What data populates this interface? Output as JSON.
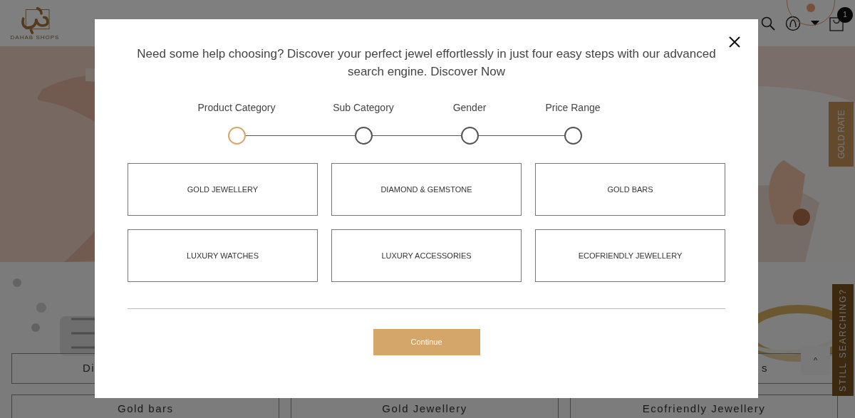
{
  "header": {
    "logo_text": "DAHAB SHOPS",
    "cart_count": "1"
  },
  "gold_rate_tab": "GOLD RATE",
  "still_searching_tab": "STILL SEARCHING?",
  "background_tiles": {
    "row_1": [
      "Di",
      "s"
    ],
    "row_2": [
      "Gold bars",
      "Gold Jewellery",
      "Ecofriendly Jewellery"
    ]
  },
  "scroll_top": "^",
  "modal": {
    "intro": "Need some help choosing? Discover your perfect jewel effortlessly in just four easy steps with our advanced search engine. Discover Now",
    "steps": [
      {
        "label": "Product Category",
        "selected": true
      },
      {
        "label": "Sub Category",
        "selected": false
      },
      {
        "label": "Gender",
        "selected": false
      },
      {
        "label": "Price Range",
        "selected": false
      }
    ],
    "options": [
      "GOLD JEWELLERY",
      "DIAMOND & GEMSTONE",
      "GOLD BARS",
      "LUXURY WATCHES",
      "LUXURY ACCESSORIES",
      "ECOFRIENDLY JEWELLERY"
    ],
    "continue": "Continue"
  }
}
